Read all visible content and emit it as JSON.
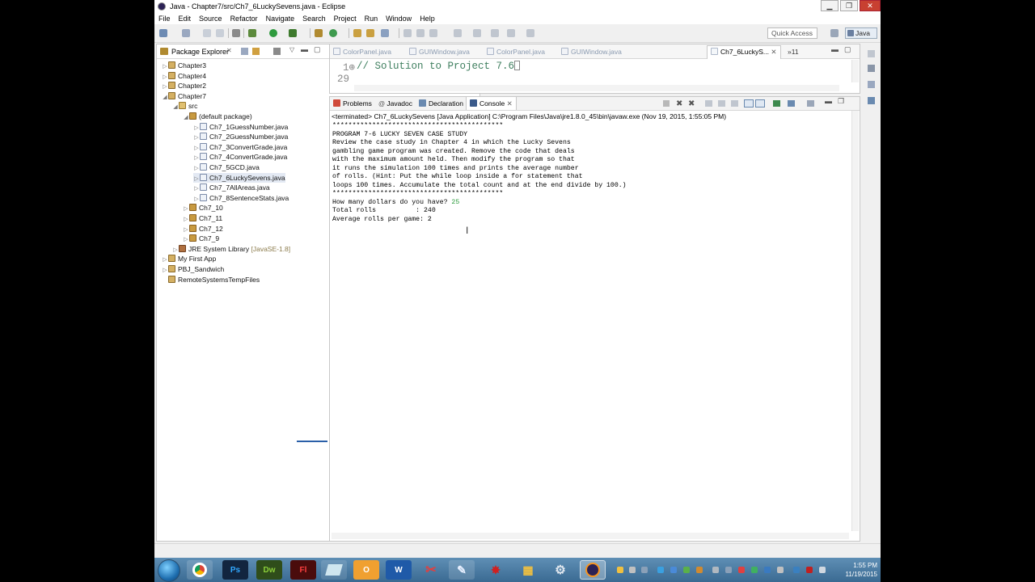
{
  "window": {
    "title": "Java - Chapter7/src/Ch7_6LuckySevens.java - Eclipse",
    "min_glyph": "▁",
    "max_glyph": "❐",
    "close_glyph": "✕"
  },
  "menu": [
    "File",
    "Edit",
    "Source",
    "Refactor",
    "Navigate",
    "Search",
    "Project",
    "Run",
    "Window",
    "Help"
  ],
  "toolbar": {
    "quick_access_placeholder": "Quick Access",
    "perspective_label": "Java"
  },
  "package_explorer": {
    "tab_label": "Package Explorer",
    "tab_close": "✕",
    "rows": [
      {
        "label": "Chapter3",
        "icon": "project-icon",
        "twisty": "▷"
      },
      {
        "label": "Chapter4",
        "icon": "project-icon",
        "twisty": "▷"
      },
      {
        "label": "Chapter2",
        "icon": "project-icon",
        "twisty": "▷"
      },
      {
        "label": "Chapter7",
        "icon": "project-icon",
        "twisty": "◢"
      },
      {
        "label": "src",
        "icon": "source-folder-icon",
        "twisty": "◢"
      },
      {
        "label": "(default package)",
        "icon": "package-icon",
        "twisty": "◢"
      },
      {
        "label": "Ch7_1GuessNumber.java",
        "icon": "java-file-icon",
        "twisty": "▷"
      },
      {
        "label": "Ch7_2GuessNumber.java",
        "icon": "java-file-icon",
        "twisty": "▷"
      },
      {
        "label": "Ch7_3ConvertGrade.java",
        "icon": "java-file-icon",
        "twisty": "▷"
      },
      {
        "label": "Ch7_4ConvertGrade.java",
        "icon": "java-file-icon",
        "twisty": "▷"
      },
      {
        "label": "Ch7_5GCD.java",
        "icon": "java-file-icon",
        "twisty": "▷"
      },
      {
        "label": "Ch7_6LuckySevens.java",
        "icon": "java-file-icon",
        "twisty": "▷"
      },
      {
        "label": "Ch7_7AllAreas.java",
        "icon": "java-file-icon",
        "twisty": "▷"
      },
      {
        "label": "Ch7_8SentenceStats.java",
        "icon": "java-file-icon",
        "twisty": "▷"
      },
      {
        "label": "Ch7_10",
        "icon": "package-icon",
        "twisty": "▷"
      },
      {
        "label": "Ch7_11",
        "icon": "package-icon",
        "twisty": "▷"
      },
      {
        "label": "Ch7_12",
        "icon": "package-icon",
        "twisty": "▷"
      },
      {
        "label": "Ch7_9",
        "icon": "package-icon",
        "twisty": "▷"
      },
      {
        "label": "JRE System Library",
        "icon": "library-icon",
        "twisty": "▷",
        "decoration": "[JavaSE-1.8]"
      },
      {
        "label": "My First App",
        "icon": "project-icon",
        "twisty": "▷"
      },
      {
        "label": "PBJ_Sandwich",
        "icon": "project-icon",
        "twisty": "▷"
      },
      {
        "label": "RemoteSystemsTempFiles",
        "icon": "project-icon",
        "twisty": ""
      }
    ]
  },
  "editor": {
    "tabs": [
      {
        "label": "ColorPanel.java",
        "active": false
      },
      {
        "label": "GUIWindow.java",
        "active": false
      },
      {
        "label": "ColorPanel.java",
        "active": false
      },
      {
        "label": "GUIWindow.java",
        "active": false
      },
      {
        "label": "Ch7_6LuckyS...",
        "active": true
      }
    ],
    "overflow_label": "»11",
    "lines": [
      {
        "num": "1⊕",
        "text": "// Solution to Project 7.6"
      },
      {
        "num": "29",
        "text": ""
      }
    ]
  },
  "console": {
    "tabs": [
      {
        "label": "Problems"
      },
      {
        "label": "Javadoc"
      },
      {
        "label": "Declaration"
      },
      {
        "label": "Console"
      }
    ],
    "terminated_line": "<terminated> Ch7_6LuckySevens [Java Application] C:\\Program Files\\Java\\jre1.8.0_45\\bin\\javaw.exe (Nov 19, 2015, 1:55:05 PM)",
    "output_lines": [
      "*******************************************",
      "PROGRAM 7-6 LUCKY SEVEN CASE STUDY",
      "Review the case study in Chapter 4 in which the Lucky Sevens",
      "gambling game program was created. Remove the code that deals",
      "with the maximum amount held. Then modify the program so that",
      "it runs the simulation 100 times and prints the average number",
      "of rolls. (Hint: Put the while loop inside a for statement that",
      "loops 100 times. Accumulate the total count and at the end divide by 100.)",
      "*******************************************",
      "How many dollars do you have? ",
      "Total rolls          : 240",
      "Average rolls per game: 2"
    ],
    "user_input": "25"
  },
  "taskbar": {
    "apps": [
      {
        "name": "chrome",
        "label": ""
      },
      {
        "name": "photoshop",
        "label": "Ps"
      },
      {
        "name": "dreamweaver",
        "label": "Dw"
      },
      {
        "name": "flash",
        "label": "Fl"
      },
      {
        "name": "notepad",
        "label": ""
      },
      {
        "name": "outlook",
        "label": "O"
      },
      {
        "name": "word",
        "label": "W"
      },
      {
        "name": "snipping-tool",
        "label": ""
      },
      {
        "name": "pen-tool",
        "label": ""
      },
      {
        "name": "splat-app",
        "label": ""
      },
      {
        "name": "grid-app",
        "label": ""
      },
      {
        "name": "gear-app",
        "label": ""
      },
      {
        "name": "eclipse",
        "label": ""
      }
    ],
    "time": "1:55 PM",
    "date": "11/19/2015"
  },
  "colors": {
    "console_input": "#2c9b3c",
    "code_comment": "#3f7f5f",
    "taskbar": "#4a7aa2"
  }
}
